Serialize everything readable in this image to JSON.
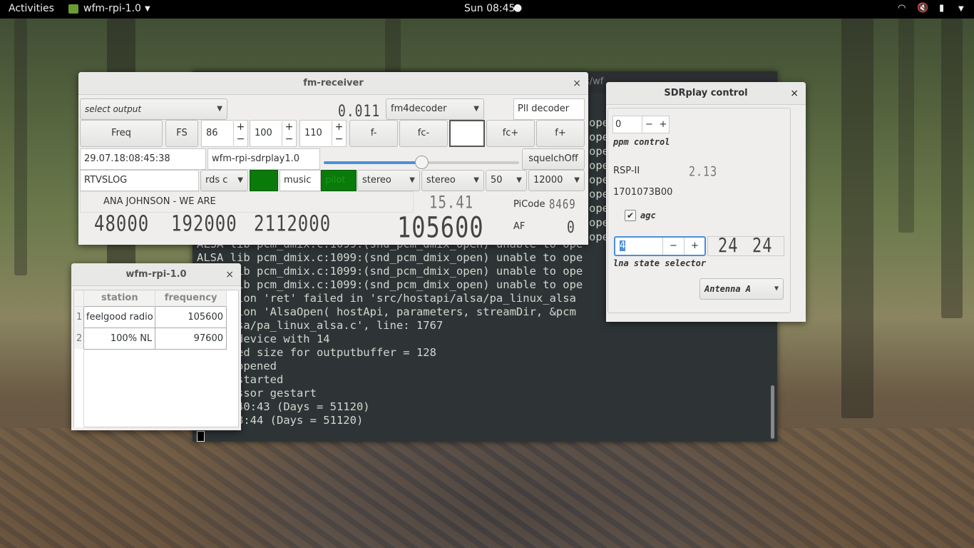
{
  "topbar": {
    "activities": "Activities",
    "app_name": "wfm-rpi-1.0",
    "clock": "Sun 08:45"
  },
  "terminal": {
    "title_fragment": "s/wf",
    "lines": [
      "",
      "",
      "",
      "",
      "",
      "",
      "",
      "",
      "",
      "ALSA lib pcm_dmix.c:1099:(snd_pcm_dmix_open) unable to ope",
      "ALSA lib pcm_dmix.c:1099:(snd_pcm_dmix_open) unable to ope",
      "     lib pcm_dmix.c:1099:(snd_pcm_dmix_open) unable to ope",
      "     lib pcm_dmix.c:1099:(snd_pcm_dmix_open) unable to ope",
      "     sion 'ret' failed in 'src/hostapi/alsa/pa_linux_alsa",
      "     sion 'AlsaOpen( hostApi, parameters, streamDir, &pcm",
      "     lsa/pa_linux_alsa.c', line: 1767",
      "      device with 14",
      "     ted size for outputbuffer = 128",
      "      opened",
      "      started",
      "     essor gestart",
      "      40:43 (Days = 51120)",
      "      8:44 (Days = 51120)"
    ],
    "right_column": [
      "ope",
      "ope",
      "ope",
      "ope",
      "ope",
      "ope",
      "ope",
      "ope",
      "ope"
    ]
  },
  "fm_receiver": {
    "title": "fm-receiver",
    "close": "×",
    "output_select": "select output",
    "lcd_small": "0.011",
    "decoder_combo": "fm4decoder",
    "pll_label": "Pll decoder",
    "buttons": {
      "freq": "Freq",
      "fs": "FS",
      "f_minus": "f-",
      "fc_minus": "fc-",
      "fc_plus": "fc+",
      "f_plus": "f+",
      "squelch": "squelchOff"
    },
    "spin1": "86",
    "spin2": "100",
    "spin3": "110",
    "datetime": "29.07.18:08:45:38",
    "device_name": "wfm-rpi-sdrplay1.0",
    "slider_value": 0.5,
    "station_label": "RTVSLOG",
    "rds_combo": "rds c",
    "music_label": "music",
    "pilot_label": "pilot",
    "stereo_combo1": "stereo",
    "stereo_combo2": "stereo",
    "deemph_combo": "50",
    "bw_combo": "12000",
    "radiotext": "ANA JOHNSON - WE ARE",
    "lcd_snr": "15.41",
    "picode_label": "PiCode",
    "picode_value": "8469",
    "rate1": "48000",
    "rate2": "192000",
    "rate3": "2112000",
    "frequency_lcd": "105600",
    "af_label": "AF",
    "af_value": "0"
  },
  "station_list": {
    "title": "wfm-rpi-1.0",
    "close": "×",
    "headers": [
      "station",
      "frequency"
    ],
    "rows": [
      {
        "num": "1",
        "station": "feelgood radio",
        "frequency": "105600"
      },
      {
        "num": "2",
        "station": "100% NL",
        "frequency": "97600"
      }
    ]
  },
  "sdrplay": {
    "title": "SDRplay control",
    "close": "×",
    "ppm_value": "0",
    "ppm_label": "ppm control",
    "model": "RSP-II",
    "version_lcd": "2.13",
    "serial": "1701073B00",
    "agc_label": "agc",
    "lna_value": "4",
    "lna_lcd1": "24",
    "lna_lcd2": "24",
    "lna_label": "lna state selector",
    "antenna": "Antenna A"
  }
}
